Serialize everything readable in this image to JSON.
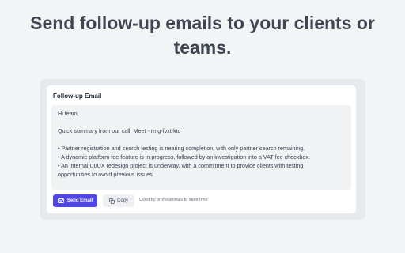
{
  "headline": {
    "line1": "Send follow-up emails to your clients or",
    "line2": "teams."
  },
  "email": {
    "title": "Follow-up Email",
    "greeting": "Hi team,",
    "summary": "Quick summary from our call: Meet - rmg-fvxt-ktc",
    "bullet1": "• Partner registration and search testing is nearing completion, with only partner search remaining.",
    "bullet2": "• A dynamic platform fee feature is in progress, followed by an investigation into a VAT fee checkbox.",
    "bullet3_line1": "• An internal UI/UX redesign project is underway, with a commitment to provide clients with testing",
    "bullet3_line2": "opportunities to avoid previous issues."
  },
  "actions": {
    "send_label": "Send Email",
    "copy_label": "Copy",
    "footnote": "Used by professionals to save time"
  },
  "icons": {
    "send": "mail-icon",
    "copy": "copy-icon"
  },
  "colors": {
    "accent": "#5046e5",
    "headline": "#3f4652"
  }
}
